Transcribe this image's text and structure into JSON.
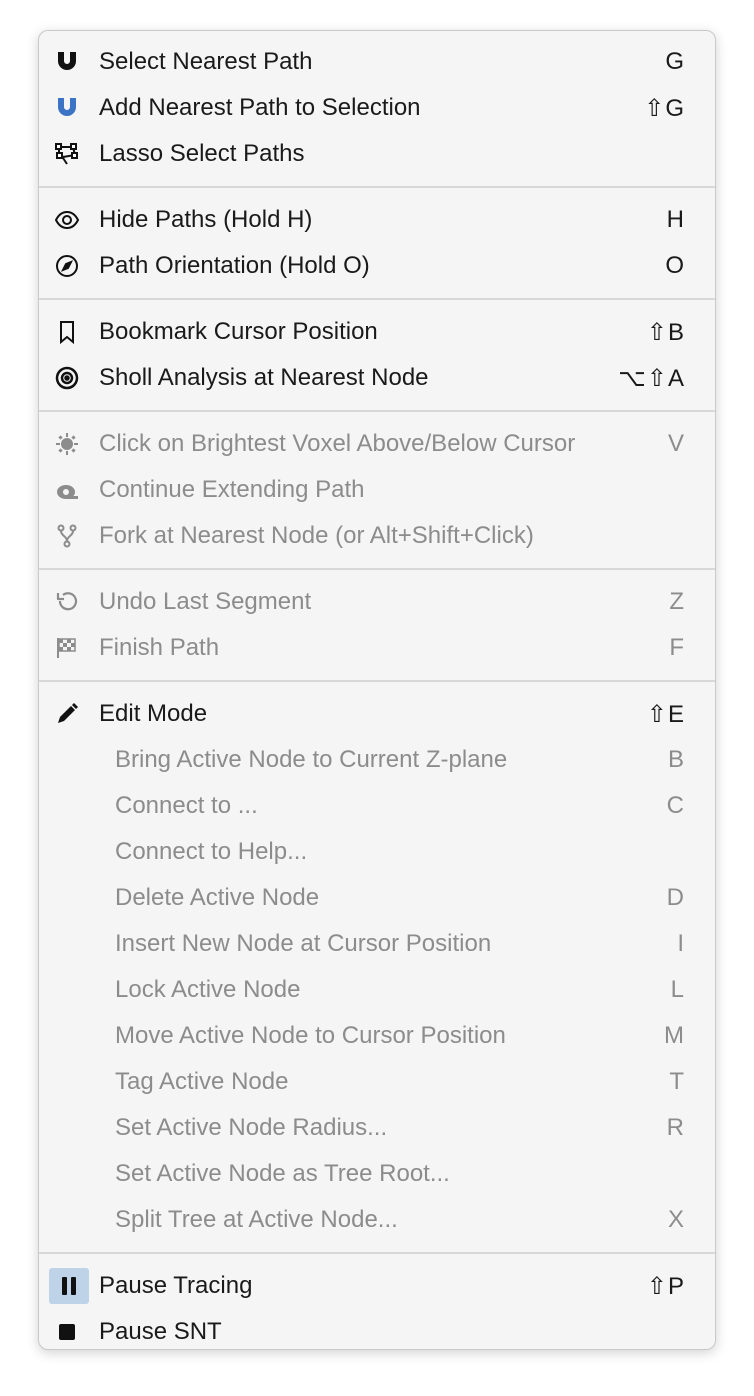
{
  "sections": [
    {
      "items": [
        {
          "icon": "magnet-icon",
          "label": "Select Nearest Path",
          "shortcut": "G",
          "disabled": false
        },
        {
          "icon": "magnet-blue-icon",
          "label": "Add Nearest Path to Selection",
          "shortcut": "⇧G",
          "disabled": false
        },
        {
          "icon": "lasso-icon",
          "label": "Lasso Select Paths",
          "shortcut": "",
          "disabled": false
        }
      ]
    },
    {
      "items": [
        {
          "icon": "eye-icon",
          "label": "Hide Paths (Hold H)",
          "shortcut": "H",
          "disabled": false
        },
        {
          "icon": "compass-icon",
          "label": "Path Orientation (Hold O)",
          "shortcut": "O",
          "disabled": false
        }
      ]
    },
    {
      "items": [
        {
          "icon": "bookmark-icon",
          "label": "Bookmark Cursor Position",
          "shortcut": "⇧B",
          "disabled": false
        },
        {
          "icon": "target-icon",
          "label": "Sholl Analysis at Nearest Node",
          "shortcut": "⌥⇧A",
          "disabled": false
        }
      ]
    },
    {
      "items": [
        {
          "icon": "sun-icon",
          "label": "Click on Brightest Voxel Above/Below Cursor",
          "shortcut": "V",
          "disabled": true
        },
        {
          "icon": "extend-icon",
          "label": "Continue Extending Path",
          "shortcut": "",
          "disabled": true
        },
        {
          "icon": "fork-icon",
          "label": "Fork at Nearest Node (or Alt+Shift+Click)",
          "shortcut": "",
          "disabled": true
        }
      ]
    },
    {
      "items": [
        {
          "icon": "undo-icon",
          "label": "Undo Last Segment",
          "shortcut": "Z",
          "disabled": true
        },
        {
          "icon": "checkered-flag-icon",
          "label": "Finish Path",
          "shortcut": "F",
          "disabled": true
        }
      ]
    },
    {
      "items": [
        {
          "icon": "pencil-icon",
          "label": "Edit  Mode",
          "shortcut": "⇧E",
          "disabled": false
        },
        {
          "icon": "",
          "label": "Bring Active Node to Current Z-plane",
          "shortcut": "B",
          "disabled": true,
          "sub": true
        },
        {
          "icon": "",
          "label": "Connect to ...",
          "shortcut": "C",
          "disabled": true,
          "sub": true
        },
        {
          "icon": "",
          "label": "Connect to Help...",
          "shortcut": "",
          "disabled": true,
          "sub": true
        },
        {
          "icon": "",
          "label": "Delete Active Node",
          "shortcut": "D",
          "disabled": true,
          "sub": true
        },
        {
          "icon": "",
          "label": "Insert New Node at Cursor Position",
          "shortcut": "I",
          "disabled": true,
          "sub": true
        },
        {
          "icon": "",
          "label": "Lock Active Node",
          "shortcut": "L",
          "disabled": true,
          "sub": true
        },
        {
          "icon": "",
          "label": "Move Active Node to Cursor Position",
          "shortcut": "M",
          "disabled": true,
          "sub": true
        },
        {
          "icon": "",
          "label": "Tag Active Node",
          "shortcut": "T",
          "disabled": true,
          "sub": true
        },
        {
          "icon": "",
          "label": "Set Active Node Radius...",
          "shortcut": "R",
          "disabled": true,
          "sub": true
        },
        {
          "icon": "",
          "label": "Set Active Node as Tree Root...",
          "shortcut": "",
          "disabled": true,
          "sub": true
        },
        {
          "icon": "",
          "label": "Split Tree at Active Node...",
          "shortcut": "X",
          "disabled": true,
          "sub": true
        }
      ]
    },
    {
      "items": [
        {
          "icon": "pause-icon",
          "label": "Pause Tracing",
          "shortcut": "⇧P",
          "disabled": false,
          "active": true
        },
        {
          "icon": "stop-icon",
          "label": "Pause SNT",
          "shortcut": "",
          "disabled": false
        }
      ]
    }
  ],
  "colors": {
    "accent_blue": "#3b74c4",
    "disabled_text": "#8c8c8c",
    "active_bg": "#bfd3e8"
  }
}
